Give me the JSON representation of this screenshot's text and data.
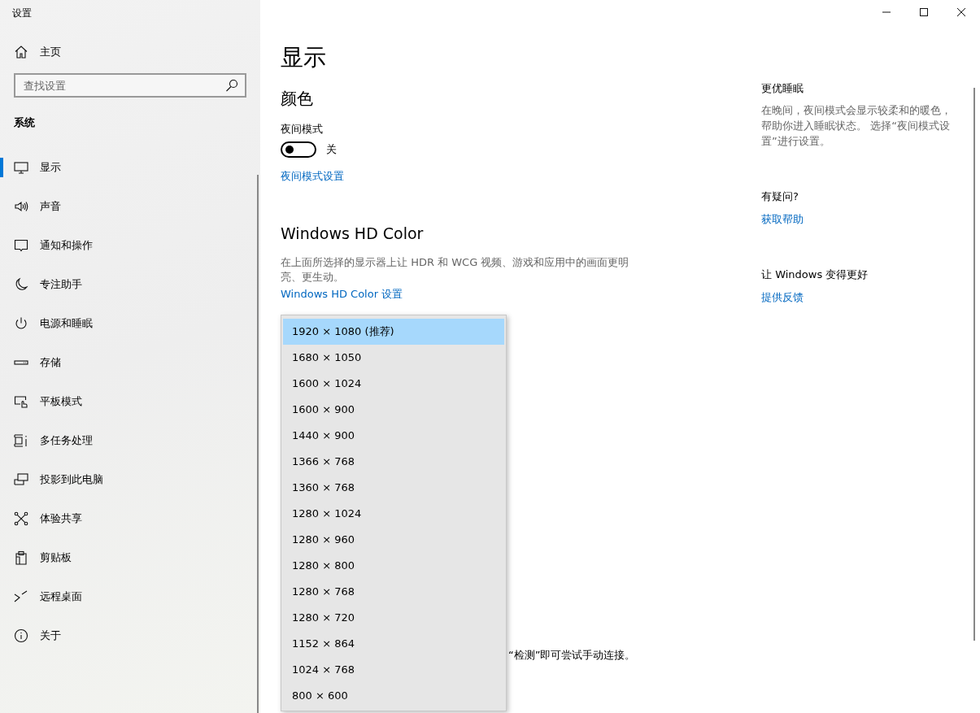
{
  "window": {
    "title": "设置"
  },
  "sidebar": {
    "home": "主页",
    "search": {
      "placeholder": "查找设置"
    },
    "section": "系统",
    "items": [
      {
        "label": "显示",
        "selected": true
      },
      {
        "label": "声音",
        "selected": false
      },
      {
        "label": "通知和操作",
        "selected": false
      },
      {
        "label": "专注助手",
        "selected": false
      },
      {
        "label": "电源和睡眠",
        "selected": false
      },
      {
        "label": "存储",
        "selected": false
      },
      {
        "label": "平板模式",
        "selected": false
      },
      {
        "label": "多任务处理",
        "selected": false
      },
      {
        "label": "投影到此电脑",
        "selected": false
      },
      {
        "label": "体验共享",
        "selected": false
      },
      {
        "label": "剪贴板",
        "selected": false
      },
      {
        "label": "远程桌面",
        "selected": false
      },
      {
        "label": "关于",
        "selected": false
      }
    ]
  },
  "main": {
    "title": "显示",
    "color_heading": "颜色",
    "night_mode": {
      "label": "夜间模式",
      "on": false,
      "state_text": "关",
      "link": "夜间模式设置"
    },
    "hd_color": {
      "heading": "Windows HD Color",
      "description": "在上面所选择的显示器上让 HDR 和 WCG 视频、游戏和应用中的画面更明亮、更生动。",
      "link": "Windows HD Color 设置"
    },
    "partly_hidden_text": "“检测”即可尝试手动连接。",
    "resolution_dropdown": [
      {
        "label": "1920 × 1080 (推荐)",
        "selected": true
      },
      {
        "label": "1680 × 1050",
        "selected": false
      },
      {
        "label": "1600 × 1024",
        "selected": false
      },
      {
        "label": "1600 × 900",
        "selected": false
      },
      {
        "label": "1440 × 900",
        "selected": false
      },
      {
        "label": "1366 × 768",
        "selected": false
      },
      {
        "label": "1360 × 768",
        "selected": false
      },
      {
        "label": "1280 × 1024",
        "selected": false
      },
      {
        "label": "1280 × 960",
        "selected": false
      },
      {
        "label": "1280 × 800",
        "selected": false
      },
      {
        "label": "1280 × 768",
        "selected": false
      },
      {
        "label": "1280 × 720",
        "selected": false
      },
      {
        "label": "1152 × 864",
        "selected": false
      },
      {
        "label": "1024 × 768",
        "selected": false
      },
      {
        "label": "800 × 600",
        "selected": false
      }
    ]
  },
  "related": [
    {
      "heading": "更优睡眠",
      "text": "在晚间，夜间模式会显示较柔和的暖色，帮助你进入睡眠状态。 选择“夜间模式设置”进行设置。"
    },
    {
      "heading": "有疑问?",
      "link": "获取帮助"
    },
    {
      "heading": "让 Windows 变得更好",
      "link": "提供反馈"
    }
  ]
}
